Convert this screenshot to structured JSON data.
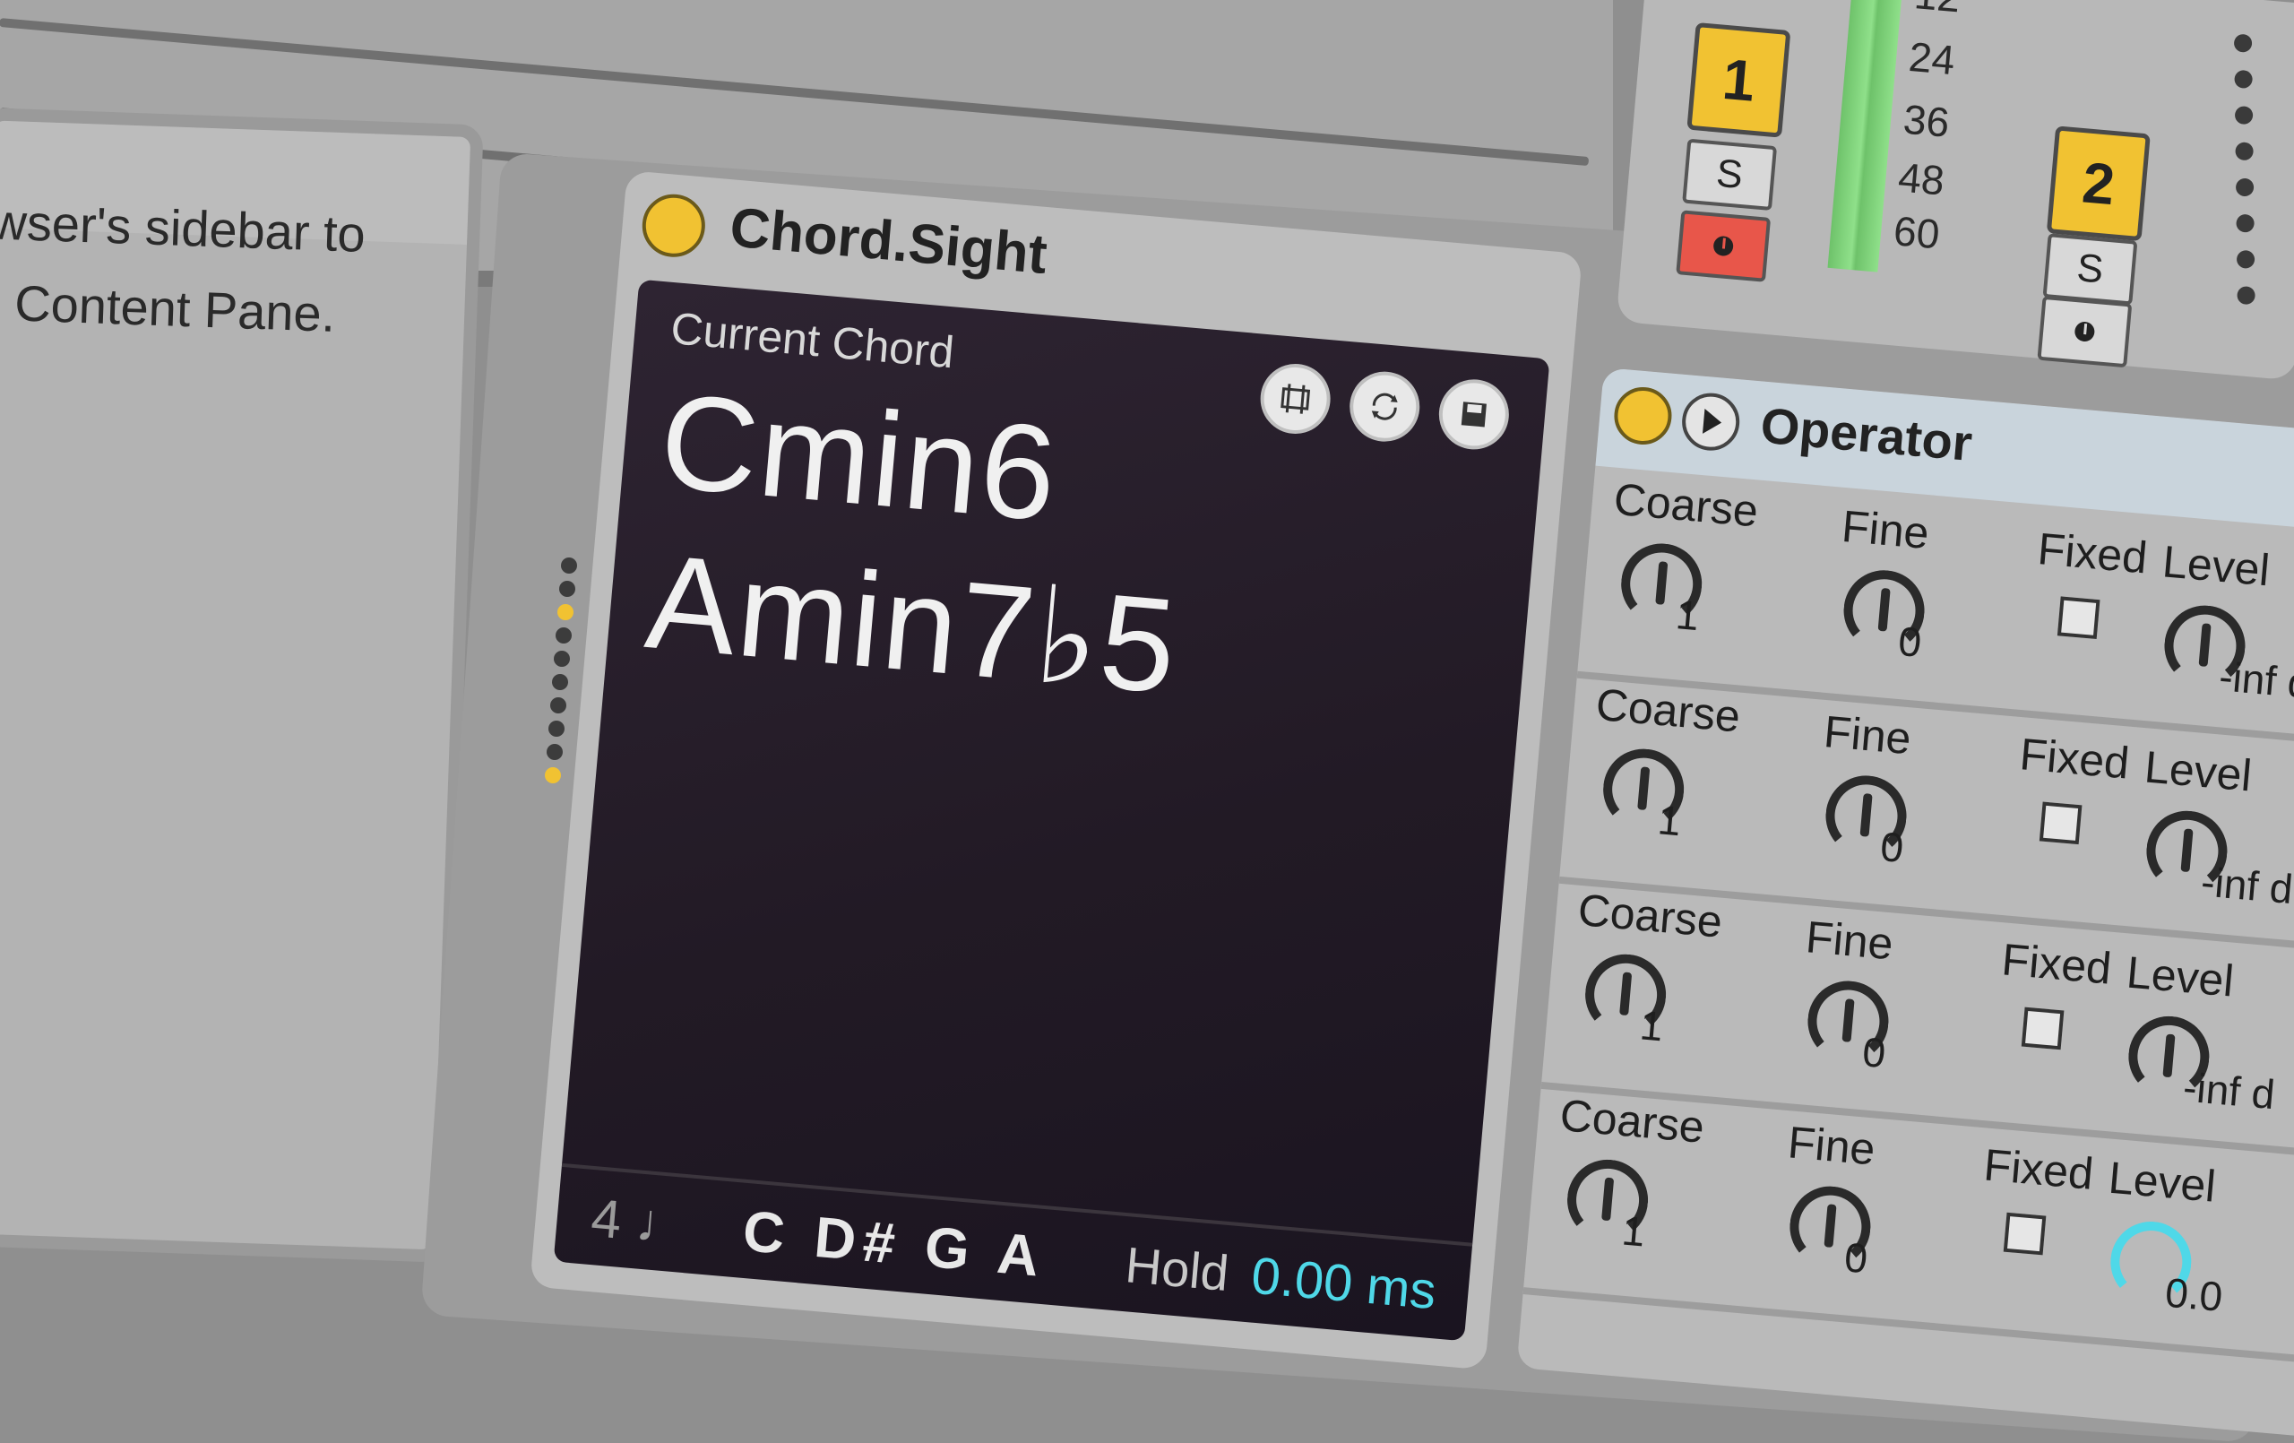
{
  "info_pane": {
    "line1": "wser's sidebar to",
    "line2": "Content Pane."
  },
  "chord_sight": {
    "title": "Chord.Sight",
    "screen_label": "Current Chord",
    "chords": [
      "Cmin6",
      "Amin7♭5"
    ],
    "voices_label": "4 ♩",
    "notes": "C D# G A",
    "hold_label": "Hold",
    "hold_value": "0.00 ms",
    "toolbar": {
      "capture_icon": "capture-icon",
      "sync_icon": "sync-icon",
      "save_icon": "save-icon"
    }
  },
  "mixer": {
    "tracks": [
      {
        "number": "1",
        "solo": "S",
        "arm_active": true
      },
      {
        "number": "2",
        "solo": "S",
        "arm_active": false
      }
    ],
    "db_scale": [
      "12",
      "24",
      "36",
      "48",
      "60"
    ]
  },
  "operator": {
    "title": "Operator",
    "rows": [
      {
        "coarse_label": "Coarse",
        "coarse_value": "1",
        "fine_label": "Fine",
        "fine_value": "0",
        "fixed_label": "Fixed",
        "level_label": "Level",
        "level_value": "-inf dB"
      },
      {
        "coarse_label": "Coarse",
        "coarse_value": "1",
        "fine_label": "Fine",
        "fine_value": "0",
        "fixed_label": "Fixed",
        "level_label": "Level",
        "level_value": "-inf dB"
      },
      {
        "coarse_label": "Coarse",
        "coarse_value": "1",
        "fine_label": "Fine",
        "fine_value": "0",
        "fixed_label": "Fixed",
        "level_label": "Level",
        "level_value": "-inf d"
      },
      {
        "coarse_label": "Coarse",
        "coarse_value": "1",
        "fine_label": "Fine",
        "fine_value": "0",
        "fixed_label": "Fixed",
        "level_label": "Level",
        "level_value": "0.0"
      }
    ]
  },
  "colors": {
    "device_on": "#f1c232",
    "hold_value": "#4fd8e8",
    "arm_active": "#e8564a",
    "meter": "#8fe08a"
  }
}
